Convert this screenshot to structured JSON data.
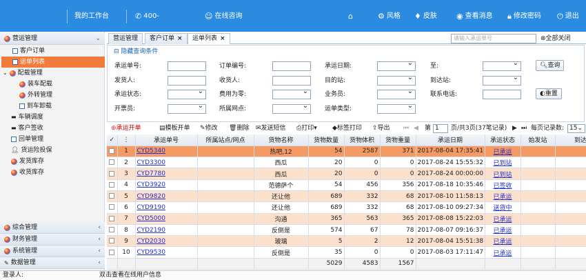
{
  "topbar": {
    "workbench": "我的工作台",
    "phone_prefix": "400-",
    "online_consult": "在线咨询",
    "style": "风格",
    "skin": "皮肤",
    "messages": "查看消息",
    "change_password": "修改密码",
    "logout": "退出",
    "color": "#2b8be0"
  },
  "sidebar": {
    "groups": [
      {
        "label": "营运管理",
        "expanded": true
      },
      {
        "label": "综合管理",
        "expanded": false
      },
      {
        "label": "财务管理",
        "expanded": false
      },
      {
        "label": "系统管理",
        "expanded": false
      },
      {
        "label": "数据管理",
        "expanded": false
      }
    ],
    "items": [
      {
        "label": "客户订单",
        "icon": "doc-icon"
      },
      {
        "label": "运单列表",
        "icon": "doc-icon",
        "active": true
      },
      {
        "label": "配载管理",
        "icon": "color-ball-icon"
      },
      {
        "label": "装车配载",
        "icon": "color-ball-icon"
      },
      {
        "label": "外转管理",
        "icon": "color-ball-icon"
      },
      {
        "label": "到车卸载",
        "icon": "doc-icon"
      },
      {
        "label": "车辆调度",
        "icon": "truck-icon"
      },
      {
        "label": "客户签收",
        "icon": "truck-icon"
      },
      {
        "label": "回单管理",
        "icon": "doc-icon"
      },
      {
        "label": "货运险投保",
        "icon": "person-icon"
      },
      {
        "label": "发货库存",
        "icon": "color-ball-icon"
      },
      {
        "label": "收货库存",
        "icon": "color-ball-icon"
      }
    ],
    "active_color": "#f07b3a"
  },
  "tabs": [
    {
      "label": "营运管理",
      "closable": false
    },
    {
      "label": "客户订单",
      "closable": true
    },
    {
      "label": "运单列表",
      "closable": true,
      "active": true
    }
  ],
  "search": {
    "placeholder": "请输入承运单号"
  },
  "close_all": "全部关闭",
  "query": {
    "legend": "隐藏查询条件",
    "labels": {
      "carrier_no": "承运单号:",
      "order_no": "订单编号:",
      "carry_date": "承运日期:",
      "to": "至:",
      "shipper": "发货人:",
      "receiver": "收货人:",
      "dest_station": "目的站:",
      "arrive_station": "到达站:",
      "status": "承运状态:",
      "fee_zero": "费用为零:",
      "salesman": "业务员:",
      "phone": "联系电话:",
      "biller": "开票员:",
      "outlet": "所属网点:",
      "waybill_type": "运单类型:"
    },
    "search_btn": "查询",
    "reset_btn": "重置"
  },
  "toolbar": {
    "add": "承运开单",
    "template": "模板开单",
    "edit": "修改",
    "delete": "删除",
    "sms": "发送短信",
    "print": "打印",
    "label_print": "标签打印",
    "export": "导出",
    "page_prefix": "第",
    "page_value": "1",
    "page_info": "页/共3页(37笔记录)",
    "per_page_label": "每页记录数:",
    "per_page": "15"
  },
  "table": {
    "headers": [
      "",
      "承运单号",
      "所属站点/网点",
      "货物名称",
      "货物数量",
      "货物体积",
      "货物重量",
      "承运日期",
      "承运状态",
      "始发站",
      "到达"
    ],
    "rows": [
      {
        "no": "1",
        "id": "CYD5340",
        "site": "",
        "name": "热吧,12",
        "qty": "54",
        "vol": "2587",
        "wt": "371",
        "date": "2017-08-04 17:35:41",
        "status": "已承运",
        "from": "",
        "to": ""
      },
      {
        "no": "2",
        "id": "CYD3300",
        "site": "",
        "name": "西瓜",
        "qty": "20",
        "vol": "0",
        "wt": "0",
        "date": "2017-08-24 15:55:32",
        "status": "已到站",
        "from": "",
        "to": ""
      },
      {
        "no": "3",
        "id": "CYD7780",
        "site": "",
        "name": "西瓜",
        "qty": "20",
        "vol": "0",
        "wt": "0",
        "date": "2017-08-24 00:00:00",
        "status": "已到站",
        "from": "",
        "to": ""
      },
      {
        "no": "4",
        "id": "CYD3920",
        "site": "",
        "name": "范德萨个",
        "qty": "54",
        "vol": "456",
        "wt": "356",
        "date": "2017-08-18 10:35:46",
        "status": "已签收",
        "from": "",
        "to": ""
      },
      {
        "no": "5",
        "id": "CYD9820",
        "site": "",
        "name": "还让他",
        "qty": "689",
        "vol": "332",
        "wt": "68",
        "date": "2017-08-10 11:58:13",
        "status": "已承运",
        "from": "",
        "to": ""
      },
      {
        "no": "6",
        "id": "CYD9190",
        "site": "",
        "name": "还让他",
        "qty": "689",
        "vol": "332",
        "wt": "68",
        "date": "2017-08-10 09:27:34",
        "status": "送货中",
        "from": "",
        "to": ""
      },
      {
        "no": "7",
        "id": "CYD5000",
        "site": "",
        "name": "沟通",
        "qty": "365",
        "vol": "563",
        "wt": "365",
        "date": "2017-08-08 15:22:03",
        "status": "已承运",
        "from": "",
        "to": ""
      },
      {
        "no": "8",
        "id": "CYD2190",
        "site": "",
        "name": "反倒是",
        "qty": "574",
        "vol": "67",
        "wt": "78",
        "date": "2017-08-07 09:16:37",
        "status": "已承运",
        "from": "",
        "to": ""
      },
      {
        "no": "9",
        "id": "CYD2030",
        "site": "",
        "name": "玻璃",
        "qty": "5",
        "vol": "2",
        "wt": "12",
        "date": "2017-08-04 15:51:38",
        "status": "已承运",
        "from": "",
        "to": ""
      },
      {
        "no": "10",
        "id": "CYD9530",
        "site": "",
        "name": "反倒是",
        "qty": "35",
        "vol": "0",
        "wt": "0",
        "date": "2017-08-03 17:11:47",
        "status": "已承运",
        "from": "",
        "to": ""
      }
    ],
    "totals": {
      "qty": "5029",
      "vol": "4583",
      "wt": "1567"
    }
  },
  "statusbar": {
    "login_label": "登录人:",
    "hint": "双击查看在线用户信息"
  }
}
